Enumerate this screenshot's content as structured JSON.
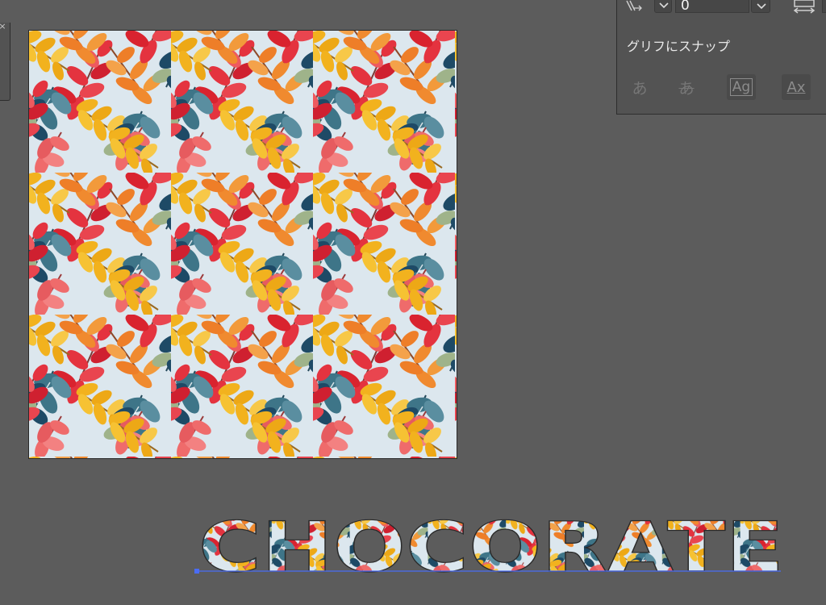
{
  "left_panel": {
    "close_icon": "close-icon"
  },
  "artboard": {
    "fill": "leaf-pattern"
  },
  "type_panel": {
    "tracking_value": "0",
    "snap_label": "グリフにスナップ",
    "glyph_buttons": [
      {
        "label": "あ",
        "icon": "proximity-glyph-icon"
      },
      {
        "label": "あ",
        "icon": "strikethrough-glyph-icon"
      },
      {
        "label": "Ag",
        "icon": "glyph-bounds-icon"
      },
      {
        "label": "Ax",
        "icon": "baseline-icon"
      }
    ]
  },
  "artwork_text": {
    "word": "CHOCORATE"
  },
  "colors": {
    "canvas": "#5c5c5c",
    "panel": "#535353",
    "pattern_bg": "#dce7ee",
    "red": "#e4333f",
    "coral": "#ef6b6b",
    "orange": "#f08a2f",
    "yellow": "#f2b21e",
    "teal": "#3e7588",
    "navy": "#1e4a66",
    "sage": "#9fb38a",
    "baseline": "#4a6cf5"
  }
}
